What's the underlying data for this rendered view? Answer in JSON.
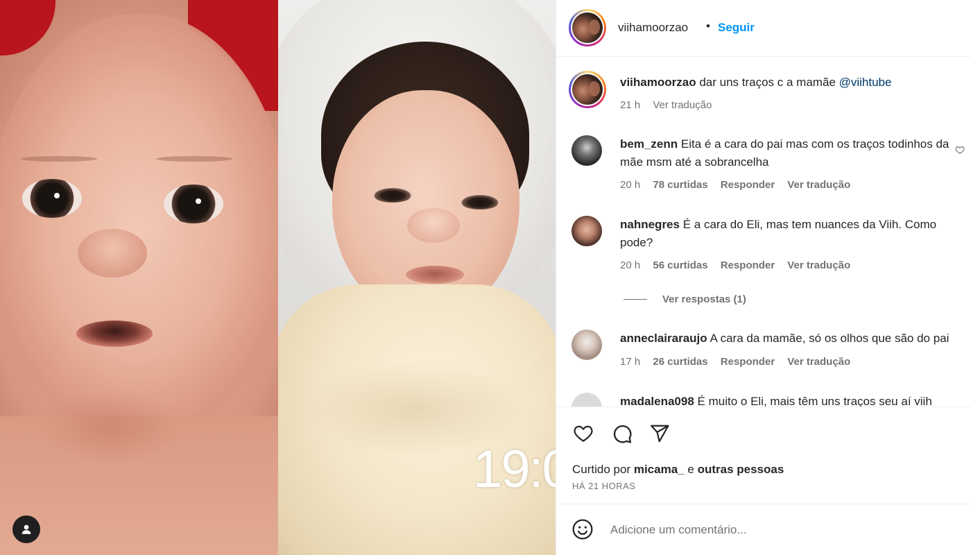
{
  "media": {
    "timestamp_overlay": "19:0"
  },
  "post": {
    "username": "viihamoorzao",
    "separator": "•",
    "follow_label": "Seguir"
  },
  "caption": {
    "username": "viihamoorzao",
    "text": "dar uns traços c a mamãe",
    "mention": "@viihtube",
    "time": "21 h",
    "translate": "Ver tradução"
  },
  "comments": [
    {
      "username": "bem_zenn",
      "line1": "Eita é a cara do pai mas com os traços todinhos da",
      "line2": "mãe msm até a sobrancelha",
      "time": "20 h",
      "likes": "78 curtidas",
      "reply": "Responder",
      "translate": "Ver tradução"
    },
    {
      "username": "nahnegres",
      "line1": "É a cara do Eli, mas tem nuances da Viih. Como",
      "line2": "pode?",
      "time": "20 h",
      "likes": "56 curtidas",
      "reply": "Responder",
      "translate": "Ver tradução",
      "view_replies": "Ver respostas (1)"
    },
    {
      "username": "anneclairaraujo",
      "line1": "A cara da mamãe, só os olhos que são do pai",
      "time": "17 h",
      "likes": "26 curtidas",
      "reply": "Responder",
      "translate": "Ver tradução"
    },
    {
      "username": "madalena098",
      "line1": "É muito o Eli, mais têm uns traços seu aí viih"
    }
  ],
  "likes": {
    "prefix": "Curtido por",
    "user": "micama_",
    "connector": "e",
    "others": "outras pessoas",
    "ago": "HÁ 21 HORAS"
  },
  "comment_box": {
    "placeholder": "Adicione um comentário..."
  },
  "icons": {
    "like": "heart-icon",
    "comment": "comment-icon",
    "share": "send-icon",
    "emoji": "emoji-icon",
    "tag": "user-tag-icon"
  },
  "colors": {
    "link_blue": "#0095f6",
    "mention_blue": "#00376b",
    "secondary_text": "#737373"
  }
}
